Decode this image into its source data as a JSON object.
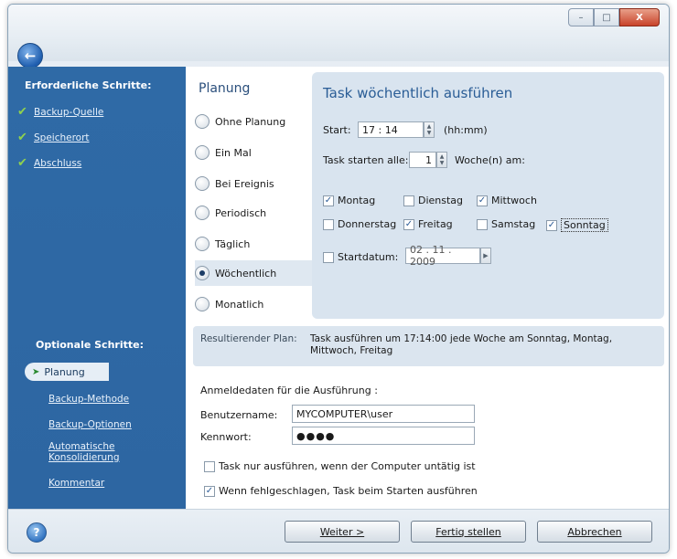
{
  "window": {
    "controls": {
      "minimize": "–",
      "maximize": "□",
      "close": "X"
    },
    "back_glyph": "←"
  },
  "sidebar": {
    "required_header": "Erforderliche Schritte:",
    "required_steps": [
      {
        "label": "Backup-Quelle",
        "done": true
      },
      {
        "label": "Speicherort",
        "done": true
      },
      {
        "label": "Abschluss",
        "done": true
      }
    ],
    "optional_header": "Optionale Schritte:",
    "active_step": "Planung",
    "optional_steps": [
      {
        "label": "Backup-Methode"
      },
      {
        "label": "Backup-Optionen"
      },
      {
        "label": "Automatische Konsolidierung"
      },
      {
        "label": "Kommentar"
      }
    ],
    "check_glyph": "✔"
  },
  "schedule": {
    "title": "Planung",
    "options": [
      {
        "label": "Ohne Planung",
        "selected": false
      },
      {
        "label": "Ein Mal",
        "selected": false
      },
      {
        "label": "Bei Ereignis",
        "selected": false
      },
      {
        "label": "Periodisch",
        "selected": false
      },
      {
        "label": "Täglich",
        "selected": false
      },
      {
        "label": "Wöchentlich",
        "selected": true
      },
      {
        "label": "Monatlich",
        "selected": false
      }
    ]
  },
  "weekly": {
    "title": "Task wöchentlich ausführen",
    "start_label": "Start:",
    "start_value": "17 : 14",
    "start_unit": "(hh:mm)",
    "every_label": "Task starten alle:",
    "every_value": "1",
    "every_unit": "Woche(n) am:",
    "days": [
      {
        "label": "Montag",
        "checked": true
      },
      {
        "label": "Dienstag",
        "checked": false
      },
      {
        "label": "Mittwoch",
        "checked": true
      },
      {
        "label": "Donnerstag",
        "checked": false
      },
      {
        "label": "Freitag",
        "checked": true
      },
      {
        "label": "Samstag",
        "checked": false
      },
      {
        "label": "Sonntag",
        "checked": true
      }
    ],
    "start_date_label": "Startdatum:",
    "start_date_checked": false,
    "start_date_value": "02 . 11 . 2009"
  },
  "result": {
    "label": "Resultierender Plan:",
    "text": "Task ausführen um 17:14:00 jede Woche am Sonntag, Montag, Mittwoch, Freitag"
  },
  "credentials": {
    "title": "Anmeldedaten für die Ausführung :",
    "username_label": "Benutzername:",
    "username_value": "MYCOMPUTER\\user",
    "password_label": "Kennwort:",
    "password_value": "●●●●"
  },
  "options": {
    "idle_label": "Task nur ausführen, wenn der Computer untätig ist",
    "idle_checked": false,
    "retry_label": "Wenn fehlgeschlagen, Task beim Starten ausführen",
    "retry_checked": true
  },
  "footer": {
    "next": "Weiter >",
    "finish": "Fertig stellen",
    "cancel": "Abbrechen",
    "help_glyph": "?"
  }
}
